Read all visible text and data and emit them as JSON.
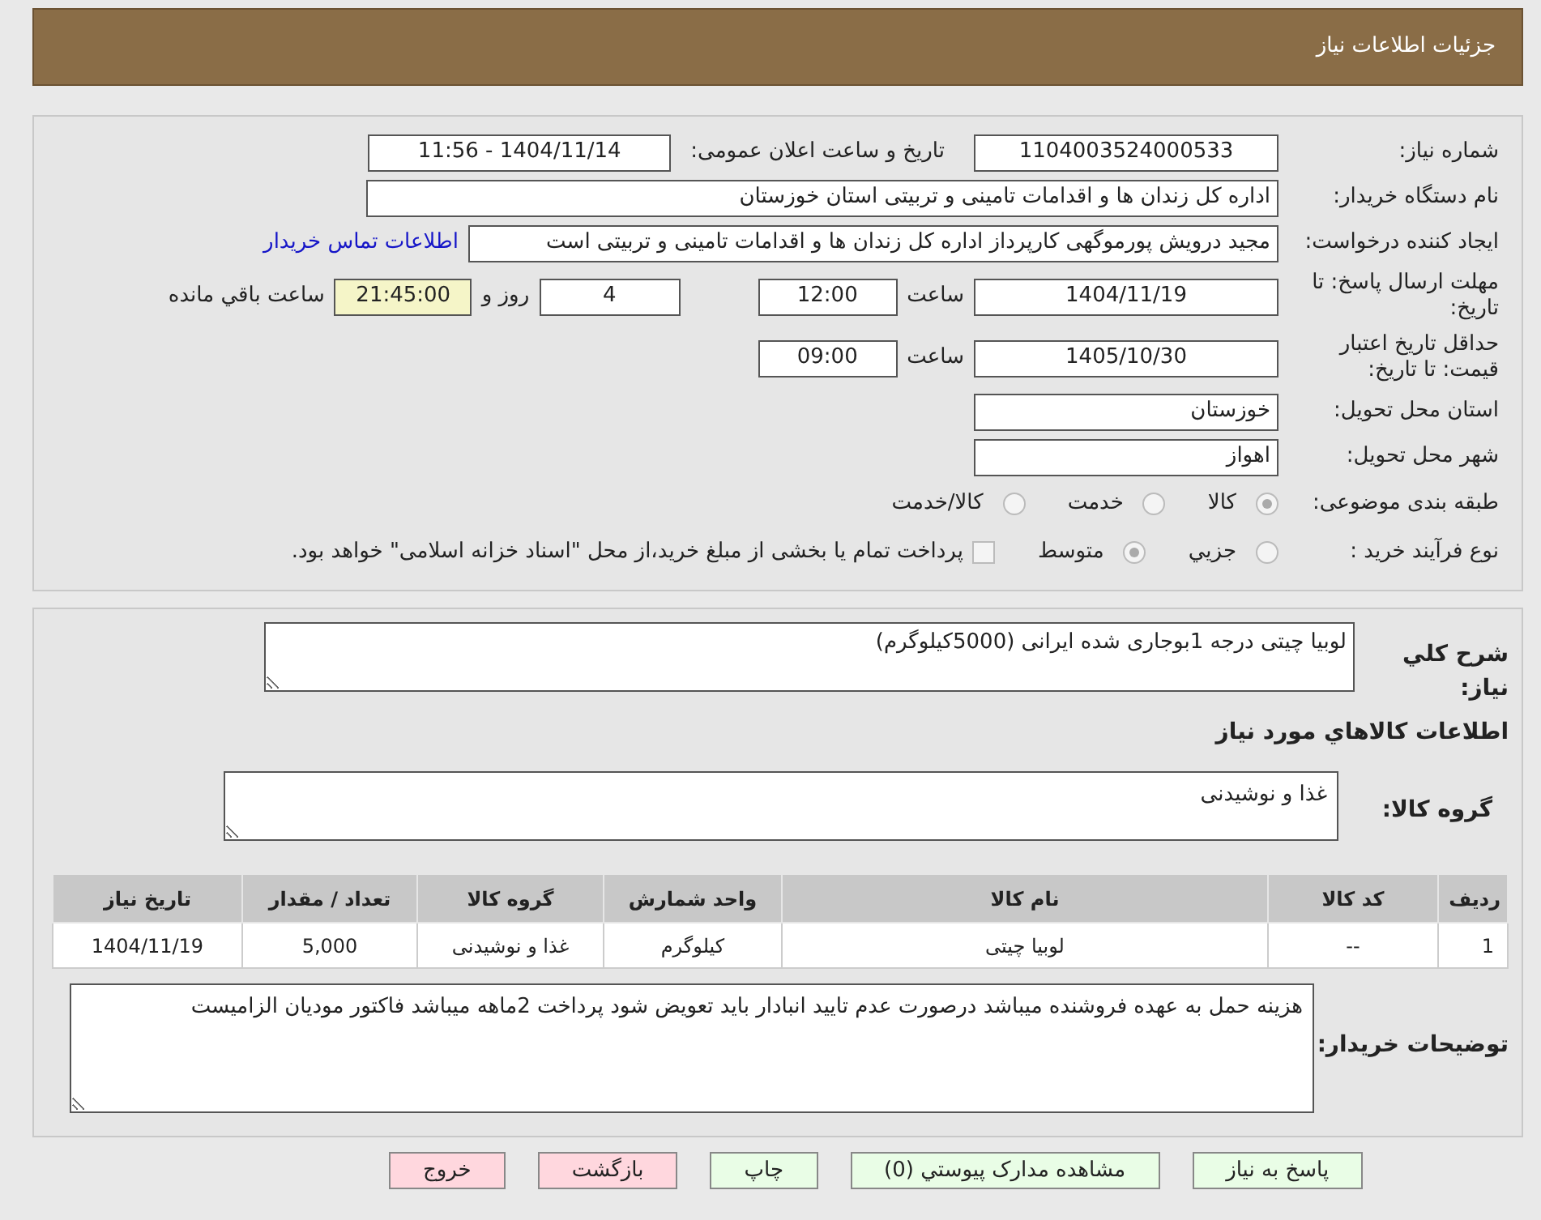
{
  "header": {
    "title": "جزئیات اطلاعات نیاز"
  },
  "details": {
    "need_number": {
      "label": "شماره نیاز:",
      "value": "1104003524000533"
    },
    "announce": {
      "label": "تاریخ و ساعت اعلان عمومی:",
      "value": "1404/11/14 - 11:56"
    },
    "buyer_org": {
      "label": "نام دستگاه خریدار:",
      "value": "اداره کل زندان ها و اقدامات تامینی و تربیتی استان خوزستان"
    },
    "requester": {
      "label": "ایجاد کننده درخواست:",
      "value": "مجید درویش پورموگهی کارپرداز اداره کل زندان ها و اقدامات تامینی و تربیتی است",
      "link": "اطلاعات تماس خریدار"
    },
    "reply_deadline": {
      "label": "مهلت ارسال پاسخ: تا تاریخ:",
      "date": "1404/11/19",
      "time_label": "ساعت",
      "time": "12:00",
      "days": "4",
      "days_label": "روز و",
      "remaining": "21:45:00",
      "remaining_label": "ساعت باقي مانده"
    },
    "price_validity": {
      "label": "حداقل تاریخ اعتبار قیمت: تا تاریخ:",
      "date": "1405/10/30",
      "time_label": "ساعت",
      "time": "09:00"
    },
    "province": {
      "label": "استان محل تحویل:",
      "value": "خوزستان"
    },
    "city": {
      "label": "شهر محل تحویل:",
      "value": "اهواز"
    },
    "category": {
      "label": "طبقه بندی موضوعی:",
      "options": [
        {
          "label": "کالا",
          "selected": true
        },
        {
          "label": "خدمت",
          "selected": false
        },
        {
          "label": "کالا/خدمت",
          "selected": false
        }
      ]
    },
    "process": {
      "label": "نوع فرآیند خرید :",
      "options": [
        {
          "label": "جزيي",
          "selected": false
        },
        {
          "label": "متوسط",
          "selected": true
        }
      ],
      "payment_note": {
        "checked": false,
        "text": "پرداخت تمام یا بخشی از مبلغ خرید،از محل \"اسناد خزانه اسلامی\" خواهد بود."
      }
    }
  },
  "items_section": {
    "summary": {
      "label": "شرح کلي نیاز:",
      "value": "لوبیا چیتی درجه 1بوجاری شده ایرانی (5000کیلوگرم)"
    },
    "title": "اطلاعات کالاهاي مورد نیاز",
    "group": {
      "label": "گروه کالا:",
      "value": "غذا و نوشیدنی"
    },
    "table": {
      "columns": [
        "ردیف",
        "کد کالا",
        "نام کالا",
        "واحد شمارش",
        "گروه کالا",
        "تعداد / مقدار",
        "تاریخ نیاز"
      ],
      "rows": [
        [
          "1",
          "--",
          "لوبیا چیتی",
          "کیلوگرم",
          "غذا و نوشیدنی",
          "5,000",
          "1404/11/19"
        ]
      ]
    },
    "buyer_notes": {
      "label": "توضیحات خریدار:",
      "value": "هزینه حمل به عهده فروشنده میباشد درصورت عدم تایید انبادار باید تعویض شود پرداخت 2ماهه میباشد فاکتور مودیان الزامیست"
    }
  },
  "buttons": [
    {
      "label": "پاسخ به نیاز",
      "kind": "primary"
    },
    {
      "label": "مشاهده مدارک پیوستي (0)",
      "kind": "primary"
    },
    {
      "label": "چاپ",
      "kind": "primary"
    },
    {
      "label": "بازگشت",
      "kind": "danger"
    },
    {
      "label": "خروج",
      "kind": "danger"
    }
  ]
}
